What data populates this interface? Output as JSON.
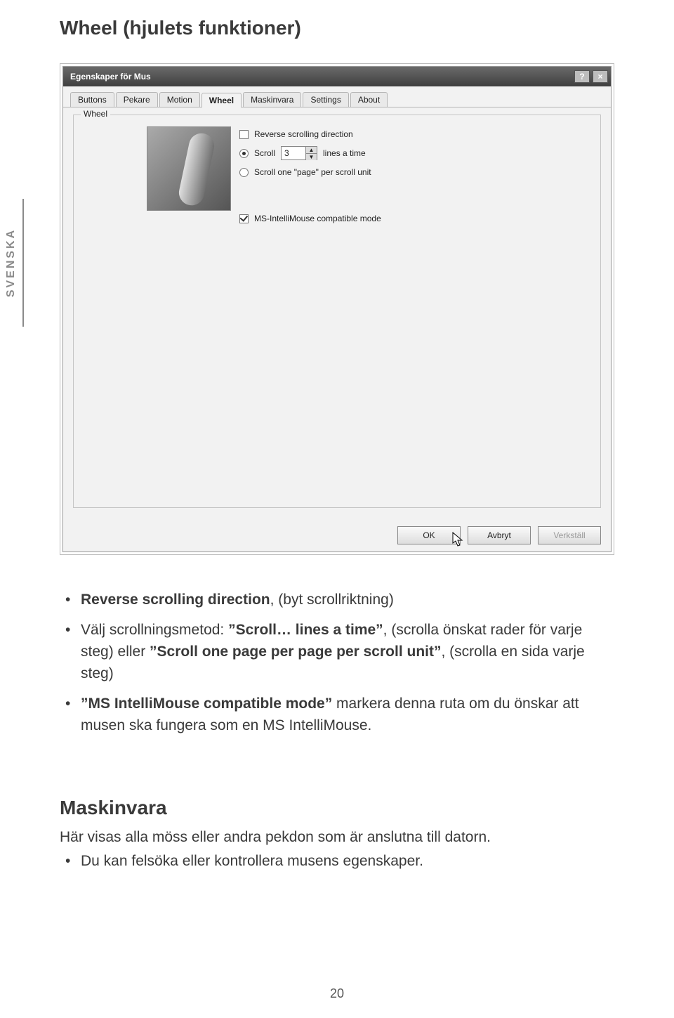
{
  "page": {
    "title": "Wheel (hjulets funktioner)",
    "side_tab": "SVENSKA",
    "page_number": "20"
  },
  "dialog": {
    "title": "Egenskaper för Mus",
    "help_symbol": "?",
    "close_symbol": "×",
    "tabs": [
      "Buttons",
      "Pekare",
      "Motion",
      "Wheel",
      "Maskinvara",
      "Settings",
      "About"
    ],
    "active_tab_index": 3,
    "group_label": "Wheel",
    "reverse_label": "Reverse scrolling direction",
    "scroll_label": "Scroll",
    "scroll_value": "3",
    "lines_label": "lines a time",
    "scroll_page_label": "Scroll one \"page\" per scroll unit",
    "intelli_label": "MS-IntelliMouse compatible mode",
    "spinner_up": "▲",
    "spinner_down": "▼",
    "buttons": {
      "ok": "OK",
      "cancel": "Avbryt",
      "apply": "Verkställ"
    }
  },
  "body": {
    "bullet1_a": "Reverse scrolling direction",
    "bullet1_b": ", (byt scrollriktning)",
    "bullet2_a": "Välj scrollningsmetod: ",
    "bullet2_b": "”Scroll… lines a time”",
    "bullet2_c": ", (scrolla önskat rader för varje steg) eller ",
    "bullet2_d": "”Scroll one page per page per scroll unit”",
    "bullet2_e": ", (scrolla en sida varje steg)",
    "bullet3_a": "”MS IntelliMouse compatible mode”",
    "bullet3_b": " markera denna ruta om du önskar att musen ska fungera som en MS IntelliMouse.",
    "subhead": "Maskinvara",
    "sub_line": "Här visas alla möss eller andra pekdon som är anslutna till datorn.",
    "sub_bullet": "Du kan felsöka eller kontrollera musens egenskaper."
  }
}
